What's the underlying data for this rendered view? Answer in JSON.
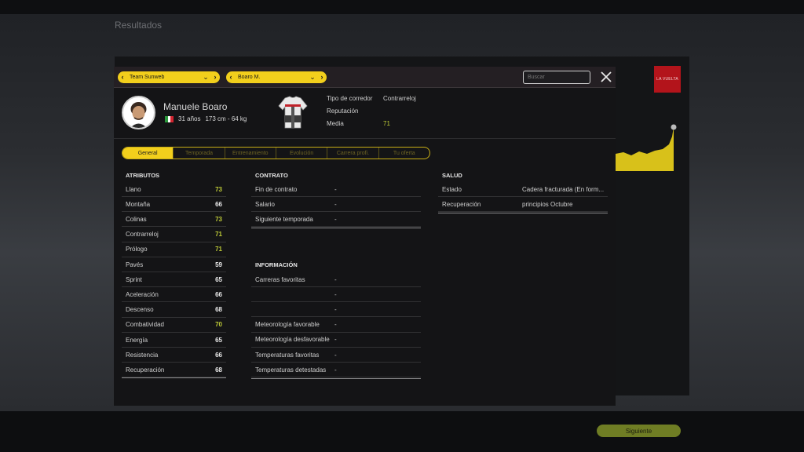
{
  "background": {
    "title": "Resultados",
    "logo_text": "LA VUELTA",
    "next_button": "Siguiente"
  },
  "header": {
    "team_selector": "Team Sunweb",
    "rider_selector": "Boaro M.",
    "search_placeholder": "Buscar"
  },
  "rider": {
    "name": "Manuele Boaro",
    "age": "31 años",
    "body": "173 cm - 64 kg",
    "flag_colors": [
      "#2b9a3d",
      "#ffffff",
      "#d3242f"
    ]
  },
  "info": {
    "type_label": "Tipo de corredor",
    "type_value": "Contrarreloj",
    "reputation_label": "Reputación",
    "media_label": "Media",
    "media_value": "71"
  },
  "tabs": [
    {
      "label": "General",
      "active": true
    },
    {
      "label": "Temporada",
      "active": false
    },
    {
      "label": "Entrenamiento",
      "active": false
    },
    {
      "label": "Evolución",
      "active": false
    },
    {
      "label": "Carrera profi.",
      "active": false
    },
    {
      "label": "Tu oferta",
      "active": false
    }
  ],
  "attributes": {
    "title": "ATRIBUTOS",
    "rows": [
      {
        "label": "Llano",
        "value": "73",
        "highlight": true
      },
      {
        "label": "Montaña",
        "value": "66",
        "highlight": false
      },
      {
        "label": "Colinas",
        "value": "73",
        "highlight": true
      },
      {
        "label": "Contrarreloj",
        "value": "71",
        "highlight": true
      },
      {
        "label": "Prólogo",
        "value": "71",
        "highlight": true
      },
      {
        "label": "Pavés",
        "value": "59",
        "highlight": false
      },
      {
        "label": "Sprint",
        "value": "65",
        "highlight": false
      },
      {
        "label": "Aceleración",
        "value": "66",
        "highlight": false
      },
      {
        "label": "Descenso",
        "value": "68",
        "highlight": false
      },
      {
        "label": "Combatividad",
        "value": "70",
        "highlight": true
      },
      {
        "label": "Energía",
        "value": "65",
        "highlight": false
      },
      {
        "label": "Resistencia",
        "value": "66",
        "highlight": false
      },
      {
        "label": "Recuperación",
        "value": "68",
        "highlight": false
      }
    ]
  },
  "contract": {
    "title": "CONTRATO",
    "rows": [
      {
        "label": "Fin de contrato",
        "value": "-"
      },
      {
        "label": "Salario",
        "value": "-"
      },
      {
        "label": "Siguiente temporada",
        "value": "-"
      }
    ]
  },
  "information": {
    "title": "INFORMACIÓN",
    "rows": [
      {
        "label": "Carreras favoritas",
        "value": "-"
      },
      {
        "label": "",
        "value": "-"
      },
      {
        "label": "",
        "value": "-"
      },
      {
        "label": "Meteorología favorable",
        "value": "-"
      },
      {
        "label": "Meteorología desfavorable",
        "value": "-"
      },
      {
        "label": "Temperaturas favoritas",
        "value": "-"
      },
      {
        "label": "Temperaturas detestadas",
        "value": "-"
      }
    ]
  },
  "health": {
    "title": "SALUD",
    "rows": [
      {
        "label": "Estado",
        "value": "Cadera fracturada (En form..."
      },
      {
        "label": "Recuperación",
        "value": "principios Octubre"
      }
    ]
  },
  "colors": {
    "accent": "#f2cf1c",
    "highlight_value": "#bfcc37"
  }
}
